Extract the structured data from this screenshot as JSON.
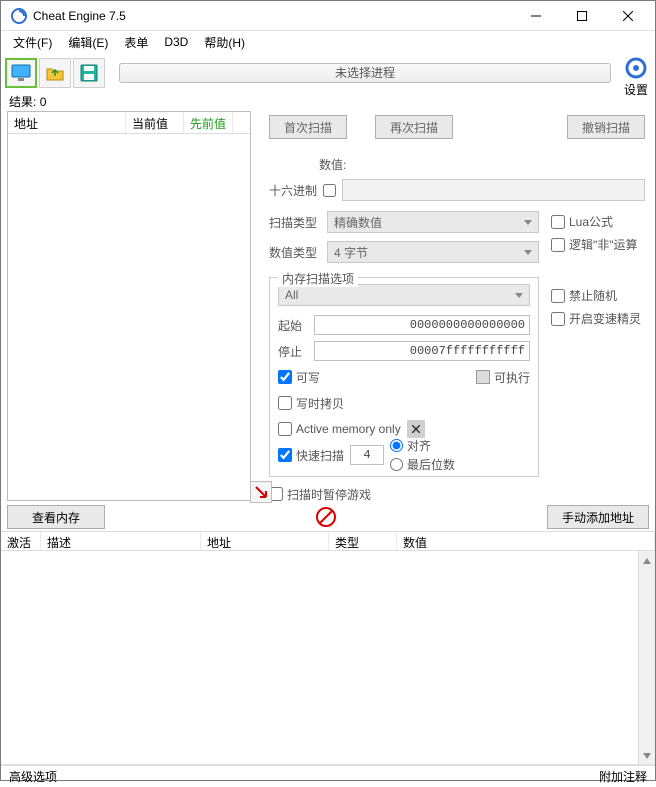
{
  "titlebar": {
    "title": "Cheat Engine 7.5"
  },
  "menu": {
    "file": "文件(F)",
    "edit": "编辑(E)",
    "table": "表单",
    "d3d": "D3D",
    "help": "帮助(H)"
  },
  "toolbar": {
    "process_status": "未选择进程",
    "settings": "设置"
  },
  "results_label_prefix": "结果:",
  "results_count": "0",
  "results_headers": {
    "address": "地址",
    "current": "当前值",
    "previous": "先前值"
  },
  "scan": {
    "first": "首次扫描",
    "next": "再次扫描",
    "undo": "撤销扫描",
    "value_label": "数值:",
    "hex_label": "十六进制",
    "scan_type_label": "扫描类型",
    "scan_type_value": "精确数值",
    "value_type_label": "数值类型",
    "value_type_value": "4 字节",
    "lua_formula": "Lua公式",
    "logic_not": "逻辑\"非\"运算"
  },
  "mem": {
    "title": "内存扫描选项",
    "all": "All",
    "start_label": "起始",
    "start_value": "0000000000000000",
    "stop_label": "停止",
    "stop_value": "00007fffffffffff",
    "writable": "可写",
    "executable": "可执行",
    "copy_on_write": "写时拷贝",
    "active_mem": "Active memory only",
    "fast_scan": "快速扫描",
    "fast_scan_value": "4",
    "align": "对齐",
    "last_digits": "最后位数",
    "pause_on_scan": "扫描时暂停游戏",
    "no_random": "禁止随机",
    "speedhack": "开启变速精灵"
  },
  "mid_buttons": {
    "view_memory": "查看内存",
    "add_manually": "手动添加地址"
  },
  "grid_headers": {
    "activate": "激活",
    "description": "描述",
    "address": "地址",
    "type": "类型",
    "value": "数值"
  },
  "bottom": {
    "advanced": "高级选项",
    "comment": "附加注释"
  }
}
